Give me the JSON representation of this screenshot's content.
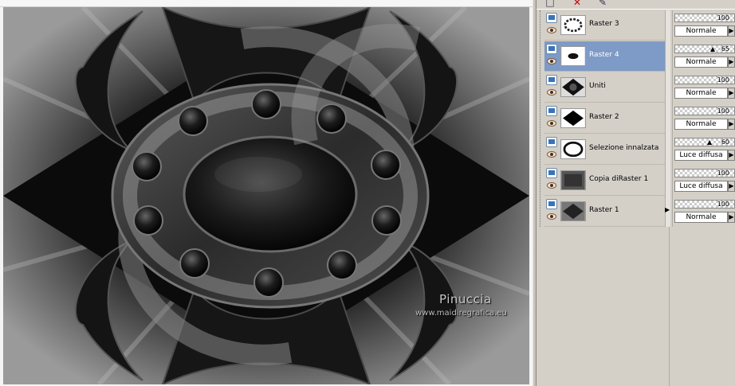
{
  "canvas": {
    "signature_name": "Pinuccia",
    "signature_url": "www.maidiregrafica.eu"
  },
  "layers_panel": {
    "toolbar_icons": [
      "layer-icon",
      "delete-layer-icon",
      "brush-icon"
    ],
    "layers": [
      {
        "name": "Raster 3",
        "opacity": "100",
        "blend": "Normale",
        "selected": false
      },
      {
        "name": "Raster 4",
        "opacity": "65",
        "blend": "Normale",
        "selected": true
      },
      {
        "name": "Uniti",
        "opacity": "100",
        "blend": "Normale",
        "selected": false
      },
      {
        "name": "Raster 2",
        "opacity": "100",
        "blend": "Normale",
        "selected": false
      },
      {
        "name": "Selezione innalzata",
        "opacity": "60",
        "blend": "Luce diffusa",
        "selected": false
      },
      {
        "name": "Copia diRaster 1",
        "opacity": "100",
        "blend": "Luce diffusa",
        "selected": false
      },
      {
        "name": "Raster 1",
        "opacity": "100",
        "blend": "Normale",
        "selected": false
      }
    ]
  },
  "colors": {
    "selection": "#7e9ac6",
    "panel_bg": "#d4d0c8"
  }
}
